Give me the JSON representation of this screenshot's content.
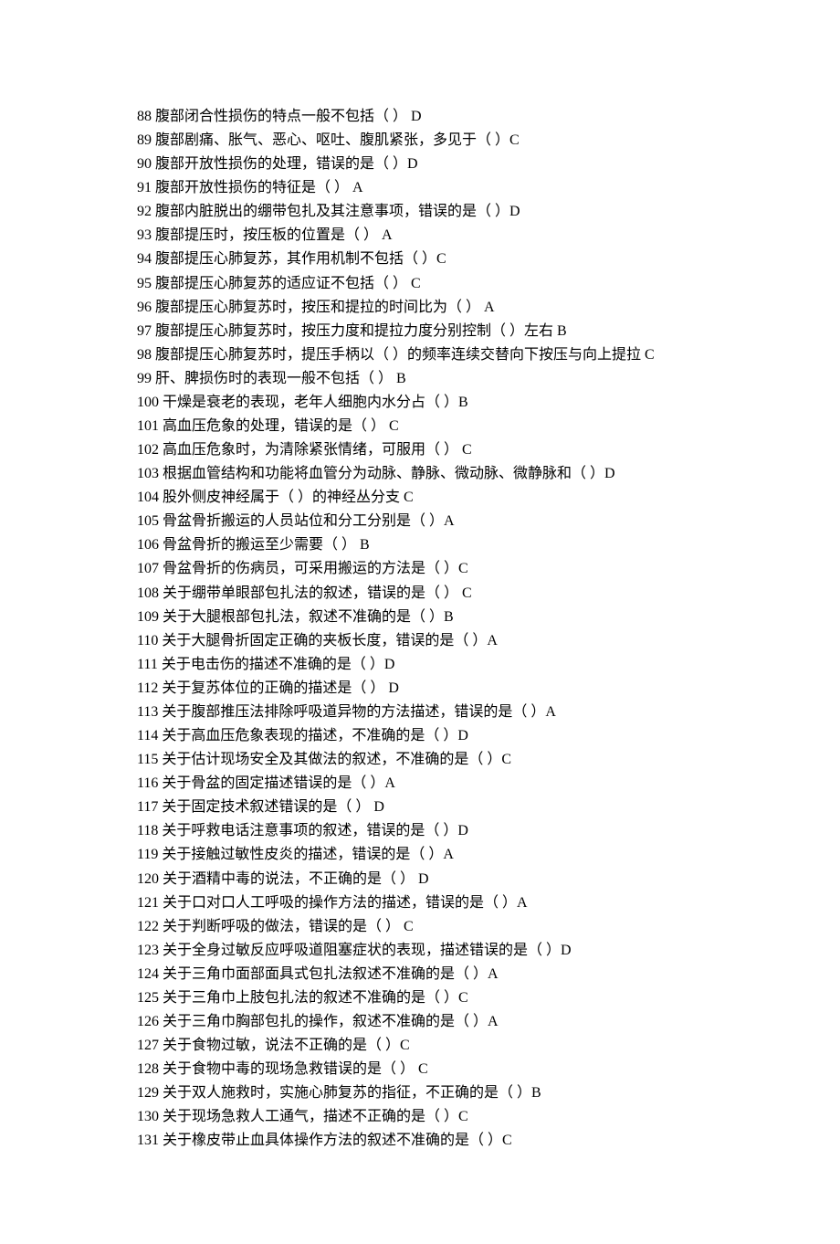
{
  "items": [
    {
      "n": "88",
      "text": "腹部闭合性损伤的特点一般不包括（ ）",
      "sep": "  ",
      "ans": "D"
    },
    {
      "n": "89",
      "text": "腹部剧痛、胀气、恶心、呕吐、腹肌紧张，多见于（ ）",
      "sep": "",
      "ans": "C"
    },
    {
      "n": "90",
      "text": "腹部开放性损伤的处理，错误的是（ ）",
      "sep": "",
      "ans": "D"
    },
    {
      "n": "91",
      "text": "腹部开放性损伤的特征是（ ）",
      "sep": " ",
      "ans": "A"
    },
    {
      "n": "92",
      "text": "腹部内脏脱出的绷带包扎及其注意事项，错误的是（ ）",
      "sep": "",
      "ans": "D"
    },
    {
      "n": "93",
      "text": "腹部提压时，按压板的位置是（ ）",
      "sep": " ",
      "ans": "A"
    },
    {
      "n": "94",
      "text": "腹部提压心肺复苏，其作用机制不包括（ ）",
      "sep": "",
      "ans": "C"
    },
    {
      "n": "95",
      "text": "腹部提压心肺复苏的适应证不包括（ ）",
      "sep": "  ",
      "ans": "C"
    },
    {
      "n": "96",
      "text": "腹部提压心肺复苏时，按压和提拉的时间比为（ ）",
      "sep": "  ",
      "ans": "A"
    },
    {
      "n": "97",
      "text": "腹部提压心肺复苏时，按压力度和提拉力度分别控制（ ）左右",
      "sep": " ",
      "ans": "B"
    },
    {
      "n": "98",
      "text": "腹部提压心肺复苏时，提压手柄以（ ）的频率连续交替向下按压与向上提拉",
      "sep": " ",
      "ans": "C"
    },
    {
      "n": "99",
      "text": "肝、脾损伤时的表现一般不包括（ ）",
      "sep": "  ",
      "ans": "B"
    },
    {
      "n": "100",
      "text": "干燥是衰老的表现，老年人细胞内水分占（ ）",
      "sep": "",
      "ans": "B"
    },
    {
      "n": "101",
      "text": "高血压危象的处理，错误的是（ ）",
      "sep": "  ",
      "ans": "C"
    },
    {
      "n": "102",
      "text": "高血压危象时，为清除紧张情绪，可服用（ ）",
      "sep": "  ",
      "ans": "C"
    },
    {
      "n": "103",
      "text": "根据血管结构和功能将血管分为动脉、静脉、微动脉、微静脉和（ ）",
      "sep": "",
      "ans": "D"
    },
    {
      "n": "104",
      "text": "股外侧皮神经属于（ ）的神经丛分支",
      "sep": " ",
      "ans": "C"
    },
    {
      "n": "105",
      "text": "骨盆骨折搬运的人员站位和分工分别是（ ）",
      "sep": "",
      "ans": "A"
    },
    {
      "n": "106",
      "text": "骨盆骨折的搬运至少需要（ ）",
      "sep": "  ",
      "ans": "B"
    },
    {
      "n": "107",
      "text": "骨盆骨折的伤病员，可采用搬运的方法是（ ）",
      "sep": "",
      "ans": "C"
    },
    {
      "n": "108",
      "text": " 关于绷带单眼部包扎法的叙述，错误的是（ ）",
      "sep": "  ",
      "ans": "C"
    },
    {
      "n": "109",
      "text": "关于大腿根部包扎法，叙述不准确的是（ ）",
      "sep": "",
      "ans": "B"
    },
    {
      "n": "110",
      "text": "关于大腿骨折固定正确的夹板长度，错误的是（ ）",
      "sep": "",
      "ans": "A"
    },
    {
      "n": "111",
      "text": "关于电击伤的描述不准确的是（ ）",
      "sep": "",
      "ans": "D"
    },
    {
      "n": "112",
      "text": "关于复苏体位的正确的描述是（ ）",
      "sep": "  ",
      "ans": "D"
    },
    {
      "n": "113",
      "text": "关于腹部推压法排除呼吸道异物的方法描述，错误的是（ ）",
      "sep": "",
      "ans": "A"
    },
    {
      "n": "114",
      "text": "关于高血压危象表现的描述，不准确的是（ ）",
      "sep": "",
      "ans": "D"
    },
    {
      "n": "115",
      "text": "关于估计现场安全及其做法的叙述，不准确的是（ ）",
      "sep": "",
      "ans": "C"
    },
    {
      "n": "116",
      "text": "关于骨盆的固定描述错误的是（ ）",
      "sep": "",
      "ans": "A"
    },
    {
      "n": "117",
      "text": "关于固定技术叙述错误的是（ ）",
      "sep": "  ",
      "ans": "D"
    },
    {
      "n": "118",
      "text": "关于呼救电话注意事项的叙述，错误的是（ ）",
      "sep": "",
      "ans": "D"
    },
    {
      "n": "119",
      "text": "关于接触过敏性皮炎的描述，错误的是（ ）",
      "sep": "",
      "ans": "A"
    },
    {
      "n": "120",
      "text": "关于酒精中毒的说法，不正确的是（ ）",
      "sep": "  ",
      "ans": "D"
    },
    {
      "n": "121",
      "text": "关于口对口人工呼吸的操作方法的描述，错误的是（ ）",
      "sep": "",
      "ans": "A"
    },
    {
      "n": "122",
      "text": "关于判断呼吸的做法，错误的是（ ）",
      "sep": "  ",
      "ans": "C"
    },
    {
      "n": "123",
      "text": "关于全身过敏反应呼吸道阻塞症状的表现，描述错误的是（ ）",
      "sep": "",
      "ans": "D"
    },
    {
      "n": "124",
      "text": "关于三角巾面部面具式包扎法叙述不准确的是（ ）",
      "sep": "",
      "ans": "A"
    },
    {
      "n": "125",
      "text": "关于三角巾上肢包扎法的叙述不准确的是（ ）",
      "sep": "",
      "ans": "C"
    },
    {
      "n": "126",
      "text": "关于三角巾胸部包扎的操作，叙述不准确的是（ ）",
      "sep": "",
      "ans": "A"
    },
    {
      "n": "127",
      "text": "关于食物过敏，说法不正确的是（ ）",
      "sep": "",
      "ans": "C"
    },
    {
      "n": "128",
      "text": "关于食物中毒的现场急救错误的是（ ）",
      "sep": "  ",
      "ans": "C"
    },
    {
      "n": "129",
      "text": "关于双人施救时，实施心肺复苏的指征，不正确的是（ ）",
      "sep": "",
      "ans": "B"
    },
    {
      "n": "130",
      "text": "关于现场急救人工通气，描述不正确的是（ ）",
      "sep": "",
      "ans": "C"
    },
    {
      "n": "131",
      "text": "关于橡皮带止血具体操作方法的叙述不准确的是（ ）",
      "sep": "",
      "ans": "C"
    }
  ]
}
